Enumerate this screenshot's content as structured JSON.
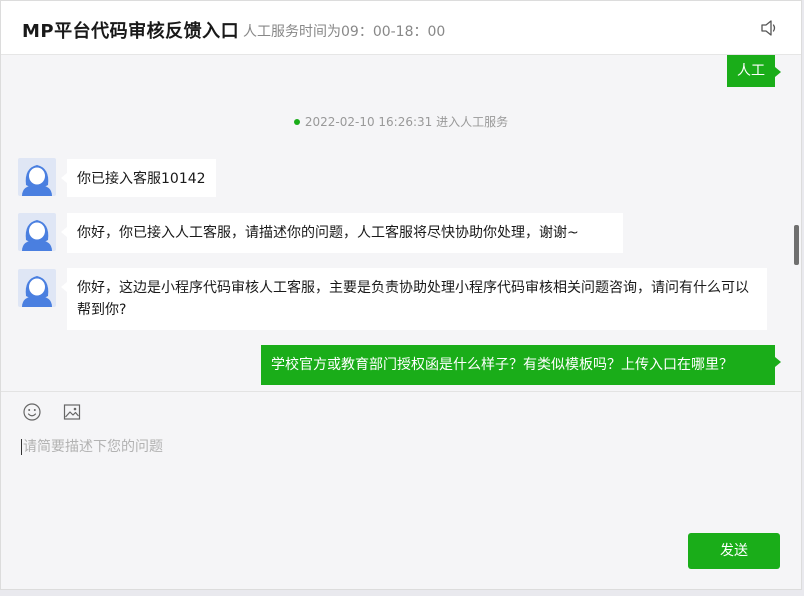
{
  "header": {
    "title": "MP平台代码审核反馈入口",
    "service_hours": "人工服务时间为09：00-18：00",
    "speaker_icon": "speaker-icon"
  },
  "chat": {
    "system_message": "2022-02-10 16:26:31 进入人工服务",
    "messages": [
      {
        "from": "user",
        "text": "人工"
      },
      {
        "from": "agent",
        "text": "你已接入客服10142"
      },
      {
        "from": "agent",
        "text": "你好，你已接入人工客服，请描述你的问题，人工客服将尽快协助你处理，谢谢~"
      },
      {
        "from": "agent",
        "text": "你好，这边是小程序代码审核人工客服，主要是负责协助处理小程序代码审核相关问题咨询，请问有什么可以帮到你?"
      },
      {
        "from": "user",
        "text": "学校官方或教育部门授权函是什么样子？有类似模板吗？上传入口在哪里？"
      }
    ]
  },
  "composer": {
    "emoji_icon": "emoji-icon",
    "image_icon": "image-icon",
    "placeholder": "请简要描述下您的问题",
    "send_label": "发送"
  },
  "colors": {
    "accent": "#1aad19",
    "avatar_bg": "#dfe6f5",
    "avatar_figure": "#4a7fe0"
  }
}
